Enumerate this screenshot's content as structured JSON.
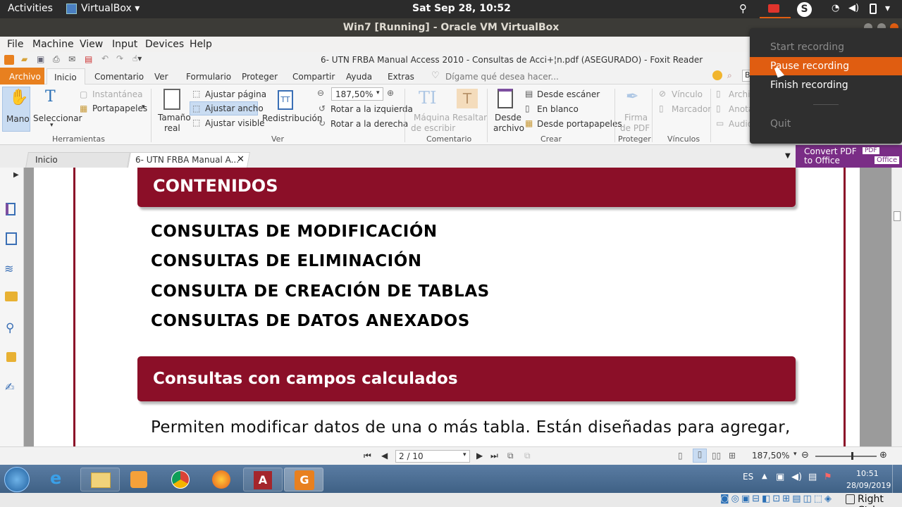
{
  "gnome": {
    "activities": "Activities",
    "app": "VirtualBox",
    "clock": "Sat Sep 28, 10:52"
  },
  "vbox": {
    "title": "Win7 [Running] - Oracle VM VirtualBox",
    "menu": [
      "File",
      "Machine",
      "View",
      "Input",
      "Devices",
      "Help"
    ],
    "right_ctrl": "Right Ctrl"
  },
  "foxit": {
    "doc_title": "6- UTN FRBA Manual Access 2010 - Consultas de Acci+¦n.pdf (ASEGURADO) - Foxit Reader",
    "tabs": [
      "Archivo",
      "Inicio",
      "Comentario",
      "Ver",
      "Formulario",
      "Proteger",
      "Compartir",
      "Ayuda",
      "Extras"
    ],
    "tell_me": "Dígame qué desea hacer...",
    "ribbon": {
      "mano": "Mano",
      "seleccionar": "Seleccionar",
      "instantanea": "Instantánea",
      "portapapeles": "Portapapeles",
      "herramientas": "Herramientas",
      "tamano1": "Tamaño",
      "tamano2": "real",
      "ajustar_pagina": "Ajustar página",
      "ajustar_ancho": "Ajustar ancho",
      "ajustar_visible": "Ajustar visible",
      "redistribucion": "Redistribución",
      "zoom": "187,50%",
      "rotar_izq": "Rotar a la izquierda",
      "rotar_der": "Rotar a la derecha",
      "ver": "Ver",
      "maquina1": "Máquina",
      "maquina2": "de escribir",
      "resaltar": "Resaltar",
      "comentario": "Comentario",
      "desde_archivo1": "Desde",
      "desde_archivo2": "archivo",
      "desde_escaner": "Desde escáner",
      "en_blanco": "En blanco",
      "desde_portapapeles": "Desde portapapeles",
      "crear": "Crear",
      "firma1": "Firma",
      "firma2": "de PDF",
      "proteger": "Proteger",
      "vinculo": "Vínculo",
      "marcador": "Marcador",
      "vinculos": "Vínculos",
      "archivo_trunc": "Archi",
      "anota_trunc": "Anota",
      "audio_trunc": "Audio"
    },
    "doc_tabs": {
      "inicio": "Inicio",
      "current": "6- UTN FRBA Manual A..."
    },
    "convert": {
      "line1": "Convert PDF",
      "line2": "to Office",
      "badge_pdf": "PDF",
      "badge_office": "Office"
    },
    "page": {
      "header1": "CONTENIDOS",
      "items": [
        "CONSULTAS DE MODIFICACIÓN",
        "CONSULTAS DE ELIMINACIÓN",
        "CONSULTA DE CREACIÓN DE TABLAS",
        "CONSULTAS DE DATOS ANEXADOS"
      ],
      "header2": "Consultas con campos calculados",
      "body": "Permiten modificar datos de una o más tabla. Están diseñadas para agregar,"
    },
    "status": {
      "page": "2 / 10",
      "zoom": "187,50%"
    }
  },
  "recording_menu": {
    "start": "Start recording",
    "pause": "Pause recording",
    "finish": "Finish recording",
    "quit": "Quit"
  },
  "win_taskbar": {
    "lang": "ES",
    "time": "10:51",
    "date": "28/09/2019"
  },
  "colors": {
    "accent": "#e05d11",
    "banner": "#8b0f28",
    "menu_highlight": "#e05d11"
  }
}
